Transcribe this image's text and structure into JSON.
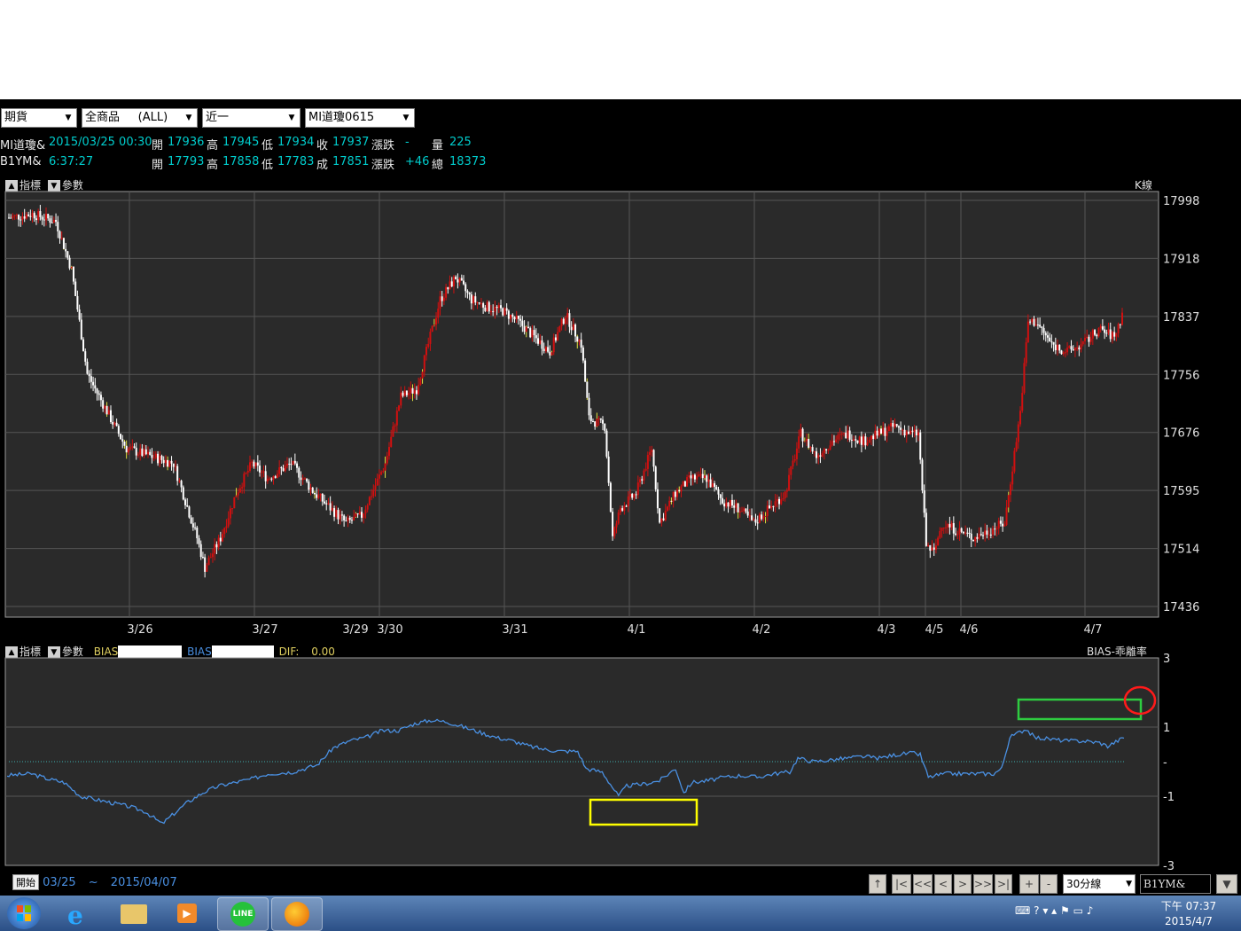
{
  "selectors": [
    {
      "label": "期貨"
    },
    {
      "label": "全商品     (ALL)"
    },
    {
      "label": "近一"
    },
    {
      "label": "MI道瓊0615"
    }
  ],
  "quote1": {
    "name": "MI道瓊&",
    "datetime": "2015/03/25 00:30",
    "open_label": "開",
    "open": "17936",
    "high_label": "高",
    "high": "17945",
    "low_label": "低",
    "low": "17934",
    "close_label": "收",
    "close": "17937",
    "chg_label": "漲跌",
    "chg": "-",
    "vol_label": "量",
    "vol": "225"
  },
  "quote2": {
    "name": "B1YM&",
    "time": "6:37:27",
    "open_label": "開",
    "open": "17793",
    "high_label": "高",
    "high": "17858",
    "low_label": "低",
    "low": "17783",
    "deal_label": "成",
    "deal": "17851",
    "chg_label": "漲跌",
    "chg": "+46",
    "total_label": "總",
    "total": "18373"
  },
  "panel_toolbar": {
    "indicator": "指標",
    "param": "參數",
    "kline": "K線"
  },
  "bias_toolbar": {
    "indicator": "指標",
    "param": "參數",
    "bias1": "BIAS",
    "bias2": "BIAS",
    "dif_label": "DIF:",
    "dif_value": "0.00",
    "title": "BIAS-乖離率"
  },
  "chart_data": [
    {
      "type": "candlestick",
      "title": "K線",
      "ylim": [
        17436,
        17998
      ],
      "yticks": [
        "17998",
        "17918",
        "17837",
        "17756",
        "17676",
        "17595",
        "17514",
        "17436"
      ],
      "x_date_labels": [
        "3/26",
        "3/27",
        "3/29",
        "3/30",
        "3/31",
        "4/1",
        "4/2",
        "4/3",
        "4/5",
        "4/6",
        "4/7"
      ],
      "close_path": [
        [
          0,
          17970
        ],
        [
          6,
          17975
        ],
        [
          12,
          17965
        ],
        [
          16,
          17900
        ],
        [
          20,
          17760
        ],
        [
          26,
          17700
        ],
        [
          30,
          17660
        ],
        [
          36,
          17650
        ],
        [
          42,
          17640
        ],
        [
          48,
          17540
        ],
        [
          50,
          17500
        ],
        [
          54,
          17540
        ],
        [
          58,
          17600
        ],
        [
          62,
          17640
        ],
        [
          66,
          17620
        ],
        [
          72,
          17640
        ],
        [
          78,
          17600
        ],
        [
          82,
          17580
        ],
        [
          86,
          17560
        ],
        [
          90,
          17570
        ],
        [
          96,
          17640
        ],
        [
          100,
          17730
        ],
        [
          104,
          17740
        ],
        [
          110,
          17860
        ],
        [
          114,
          17890
        ],
        [
          118,
          17860
        ],
        [
          122,
          17850
        ],
        [
          126,
          17845
        ],
        [
          130,
          17830
        ],
        [
          134,
          17810
        ],
        [
          138,
          17790
        ],
        [
          142,
          17840
        ],
        [
          146,
          17800
        ],
        [
          148,
          17700
        ],
        [
          152,
          17690
        ],
        [
          154,
          17540
        ],
        [
          156,
          17580
        ],
        [
          160,
          17600
        ],
        [
          164,
          17660
        ],
        [
          166,
          17560
        ],
        [
          170,
          17600
        ],
        [
          174,
          17620
        ],
        [
          178,
          17620
        ],
        [
          182,
          17590
        ],
        [
          186,
          17580
        ],
        [
          190,
          17560
        ],
        [
          194,
          17580
        ],
        [
          198,
          17600
        ],
        [
          202,
          17680
        ],
        [
          206,
          17650
        ],
        [
          210,
          17670
        ],
        [
          214,
          17680
        ],
        [
          218,
          17670
        ],
        [
          222,
          17680
        ],
        [
          226,
          17690
        ],
        [
          230,
          17680
        ],
        [
          232,
          17680
        ],
        [
          234,
          17530
        ],
        [
          236,
          17520
        ],
        [
          238,
          17560
        ],
        [
          242,
          17550
        ],
        [
          246,
          17540
        ],
        [
          250,
          17550
        ],
        [
          254,
          17560
        ],
        [
          258,
          17710
        ],
        [
          260,
          17830
        ],
        [
          262,
          17830
        ],
        [
          266,
          17800
        ],
        [
          270,
          17790
        ],
        [
          274,
          17800
        ],
        [
          278,
          17820
        ],
        [
          282,
          17810
        ],
        [
          284,
          17840
        ]
      ]
    },
    {
      "type": "line",
      "title": "BIAS-乖離率",
      "ylim": [
        -3,
        3
      ],
      "yticks": [
        "3",
        "1",
        "-",
        "-1",
        "-3"
      ],
      "series": [
        {
          "name": "BIAS",
          "color": "#4a90e2",
          "values": [
            [
              0,
              -0.4
            ],
            [
              6,
              -0.35
            ],
            [
              10,
              -0.5
            ],
            [
              14,
              -0.6
            ],
            [
              18,
              -1.0
            ],
            [
              22,
              -1.1
            ],
            [
              26,
              -1.2
            ],
            [
              30,
              -1.3
            ],
            [
              34,
              -1.45
            ],
            [
              38,
              -1.8
            ],
            [
              40,
              -1.6
            ],
            [
              44,
              -1.2
            ],
            [
              48,
              -0.9
            ],
            [
              52,
              -0.7
            ],
            [
              56,
              -0.6
            ],
            [
              60,
              -0.5
            ],
            [
              64,
              -0.35
            ],
            [
              70,
              -0.3
            ],
            [
              76,
              -0.1
            ],
            [
              80,
              0.4
            ],
            [
              84,
              0.6
            ],
            [
              88,
              0.7
            ],
            [
              92,
              0.9
            ],
            [
              96,
              0.9
            ],
            [
              100,
              1.1
            ],
            [
              104,
              1.2
            ],
            [
              108,
              1.15
            ],
            [
              112,
              1.0
            ],
            [
              116,
              0.85
            ],
            [
              120,
              0.7
            ],
            [
              124,
              0.6
            ],
            [
              128,
              0.45
            ],
            [
              132,
              0.35
            ],
            [
              136,
              0.3
            ],
            [
              140,
              0.3
            ],
            [
              142,
              -0.2
            ],
            [
              146,
              -0.3
            ],
            [
              150,
              -1.0
            ],
            [
              152,
              -0.7
            ],
            [
              156,
              -0.65
            ],
            [
              160,
              -0.55
            ],
            [
              164,
              -0.2
            ],
            [
              166,
              -0.9
            ],
            [
              168,
              -0.6
            ],
            [
              172,
              -0.55
            ],
            [
              176,
              -0.45
            ],
            [
              180,
              -0.4
            ],
            [
              184,
              -0.45
            ],
            [
              188,
              -0.35
            ],
            [
              192,
              -0.3
            ],
            [
              194,
              0.1
            ],
            [
              198,
              0.0
            ],
            [
              202,
              0.05
            ],
            [
              206,
              0.1
            ],
            [
              210,
              0.15
            ],
            [
              214,
              0.1
            ],
            [
              218,
              0.2
            ],
            [
              222,
              0.25
            ],
            [
              224,
              0.2
            ],
            [
              226,
              -0.45
            ],
            [
              230,
              -0.35
            ],
            [
              234,
              -0.35
            ],
            [
              238,
              -0.35
            ],
            [
              242,
              -0.35
            ],
            [
              244,
              -0.2
            ],
            [
              246,
              0.7
            ],
            [
              250,
              0.95
            ],
            [
              252,
              0.7
            ],
            [
              256,
              0.65
            ],
            [
              260,
              0.6
            ],
            [
              264,
              0.6
            ],
            [
              268,
              0.55
            ],
            [
              270,
              0.45
            ],
            [
              274,
              0.7
            ]
          ]
        }
      ]
    }
  ],
  "date_range": {
    "start_label": "開始",
    "start": "03/25",
    "sep": "~",
    "end": "2015/04/07"
  },
  "nav": {
    "up": "↑",
    "first": "|<",
    "fast_back": "<<",
    "back": "<",
    "fwd": ">",
    "fast_fwd": ">>",
    "last": ">|",
    "plus": "+",
    "minus": "-",
    "period": "30分線",
    "symbol": "B1YM&"
  },
  "taskbar": {
    "time": "下午 07:37",
    "date": "2015/4/7",
    "icons": [
      "start-orb",
      "ie-icon",
      "explorer-icon",
      "media-player-icon",
      "line-icon",
      "firefox-icon"
    ],
    "highlight_colors": {
      "yellow": "#ffff00",
      "green": "#2ecc40",
      "red": "#ff1a1a"
    }
  }
}
